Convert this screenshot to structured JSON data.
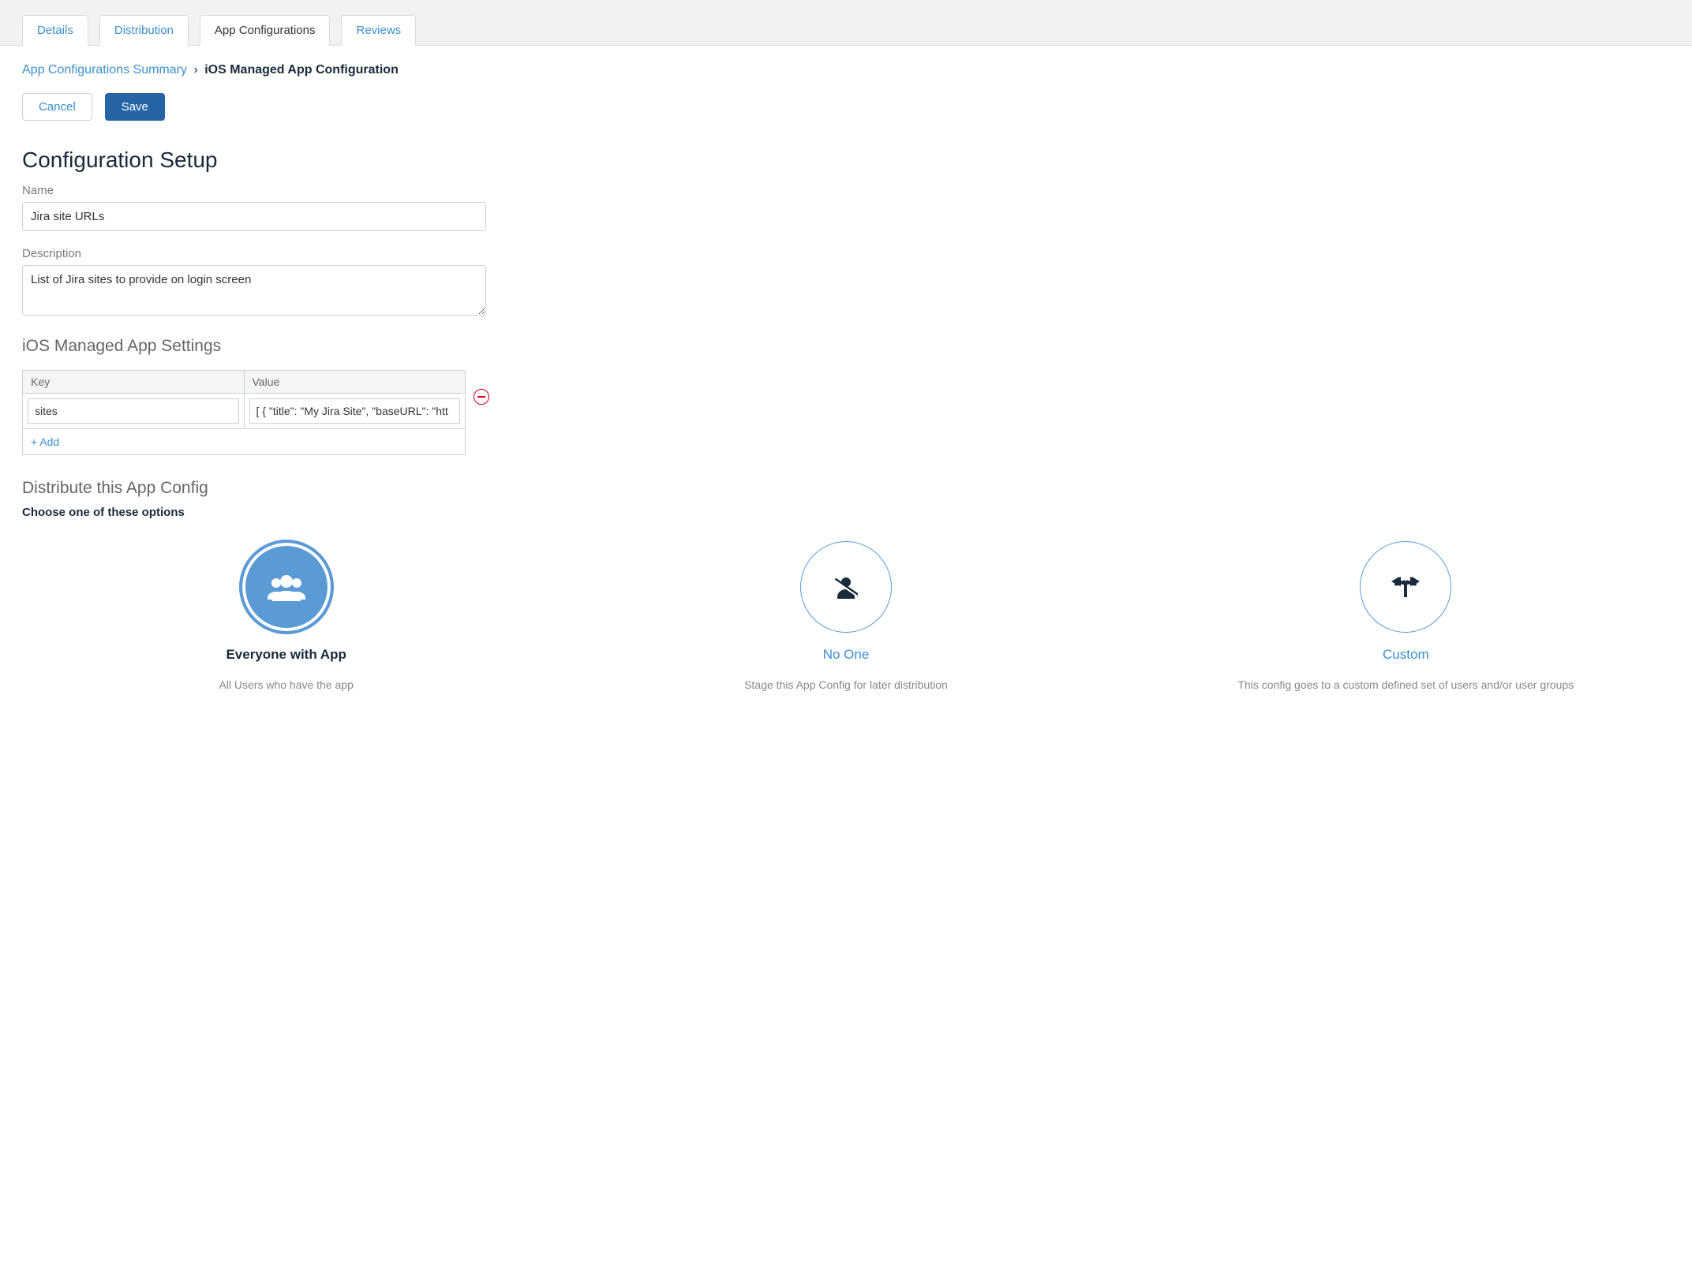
{
  "tabs": [
    "Details",
    "Distribution",
    "App Configurations",
    "Reviews"
  ],
  "activeTabIndex": 2,
  "breadcrumb": {
    "parent": "App Configurations Summary",
    "sep": "›",
    "current": "iOS Managed App Configuration"
  },
  "buttons": {
    "cancel": "Cancel",
    "save": "Save"
  },
  "section_title": "Configuration Setup",
  "name_label": "Name",
  "name_value": "Jira site URLs",
  "description_label": "Description",
  "description_value": "List of Jira sites to provide on login screen",
  "settings_title": "iOS Managed App Settings",
  "kv": {
    "key_header": "Key",
    "value_header": "Value",
    "rows": [
      {
        "key": "sites",
        "value": "[ { \"title\": \"My Jira Site\", \"baseURL\": \"htt"
      }
    ],
    "add_label": "+ Add"
  },
  "distribute": {
    "title": "Distribute this App Config",
    "subtitle": "Choose one of these options",
    "options": [
      {
        "id": "everyone",
        "title": "Everyone with App",
        "desc": "All Users who have the app",
        "selected": true
      },
      {
        "id": "noone",
        "title": "No One",
        "desc": "Stage this App Config for later distribution",
        "selected": false
      },
      {
        "id": "custom",
        "title": "Custom",
        "desc": "This config goes to a custom defined set of users and/or user groups",
        "selected": false
      }
    ]
  }
}
